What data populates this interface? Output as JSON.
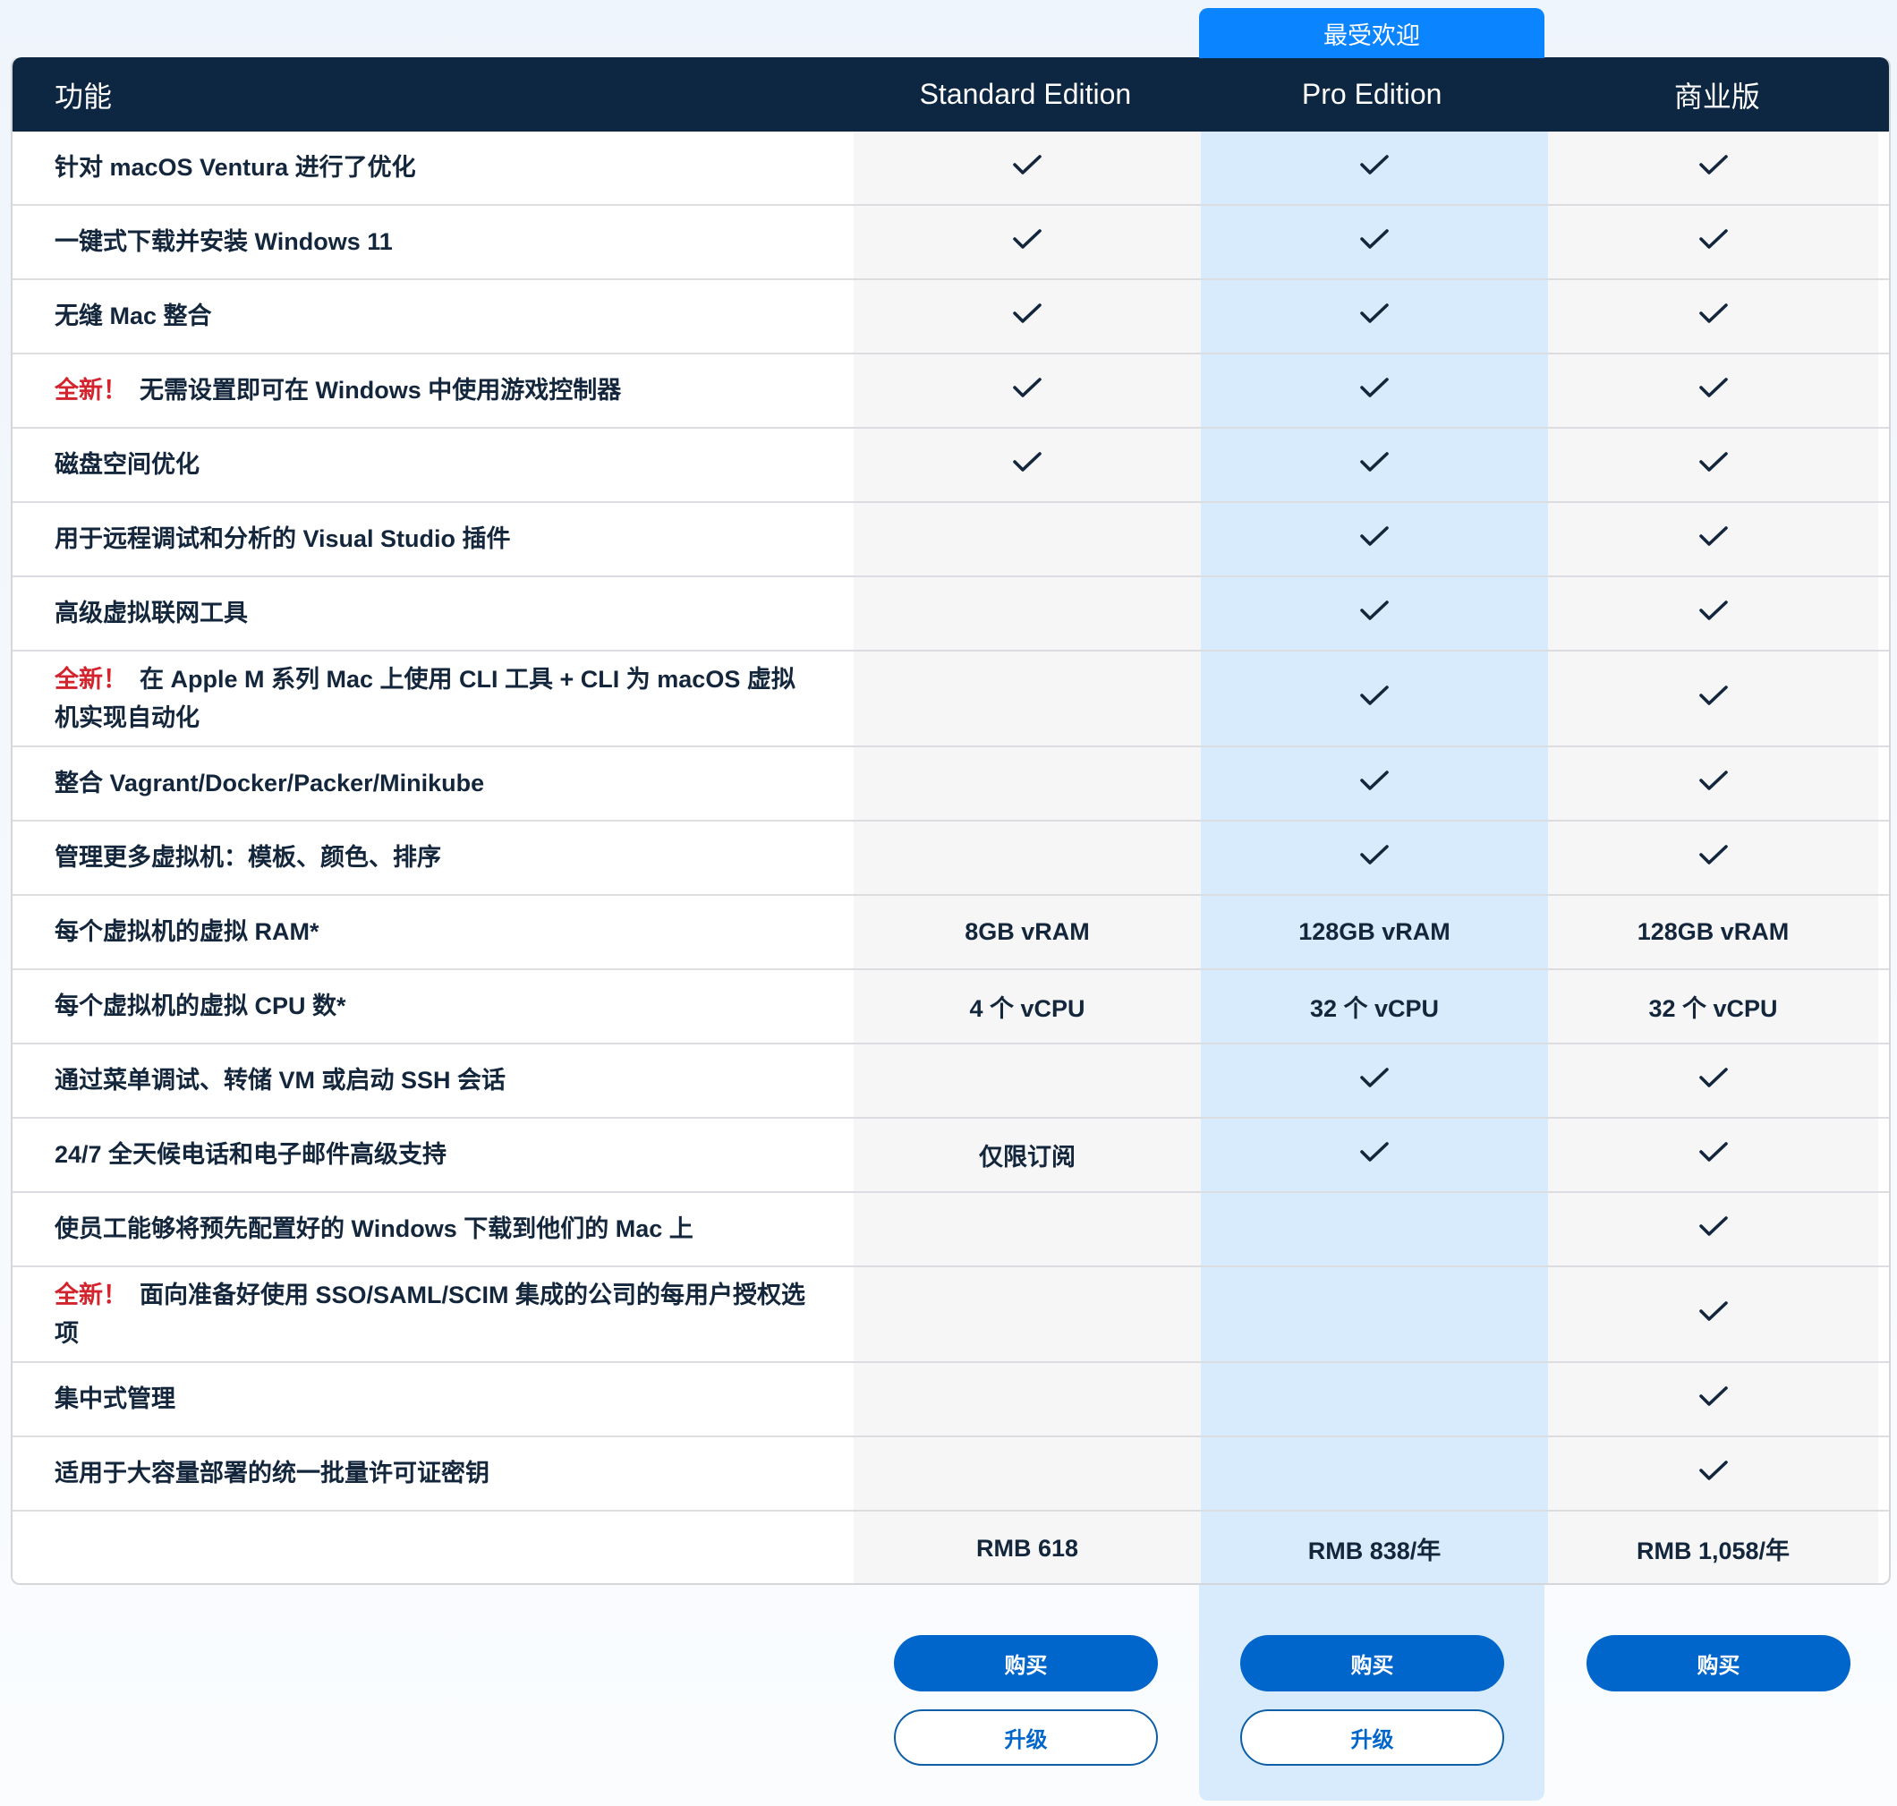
{
  "badge": "最受欢迎",
  "header": {
    "feature": "功能",
    "columns": [
      "Standard Edition",
      "Pro Edition",
      "商业版"
    ]
  },
  "new_label": "全新！",
  "check_icon": "checkmark-icon",
  "rows": [
    {
      "feature": "针对 macOS Ventura 进行了优化",
      "isNew": false,
      "values": [
        "check",
        "check",
        "check"
      ],
      "tall": false
    },
    {
      "feature": "一键式下载并安装 Windows 11",
      "isNew": false,
      "values": [
        "check",
        "check",
        "check"
      ],
      "tall": false
    },
    {
      "feature": "无缝 Mac 整合",
      "isNew": false,
      "values": [
        "check",
        "check",
        "check"
      ],
      "tall": false
    },
    {
      "feature": "无需设置即可在 Windows 中使用游戏控制器",
      "isNew": true,
      "values": [
        "check",
        "check",
        "check"
      ],
      "tall": false
    },
    {
      "feature": "磁盘空间优化",
      "isNew": false,
      "values": [
        "check",
        "check",
        "check"
      ],
      "tall": false
    },
    {
      "feature": "用于远程调试和分析的 Visual Studio 插件",
      "isNew": false,
      "values": [
        "",
        "check",
        "check"
      ],
      "tall": false
    },
    {
      "feature": "高级虚拟联网工具",
      "isNew": false,
      "values": [
        "",
        "check",
        "check"
      ],
      "tall": false
    },
    {
      "feature": "在 Apple M 系列 Mac 上使用 CLI 工具 + CLI 为 macOS 虚拟机实现自动化",
      "isNew": true,
      "values": [
        "",
        "check",
        "check"
      ],
      "tall": true
    },
    {
      "feature": "整合 Vagrant/Docker/Packer/Minikube",
      "isNew": false,
      "values": [
        "",
        "check",
        "check"
      ],
      "tall": false
    },
    {
      "feature": "管理更多虚拟机：模板、颜色、排序",
      "isNew": false,
      "values": [
        "",
        "check",
        "check"
      ],
      "tall": false
    },
    {
      "feature": "每个虚拟机的虚拟 RAM*",
      "isNew": false,
      "values": [
        "8GB vRAM",
        "128GB vRAM",
        "128GB vRAM"
      ],
      "tall": false
    },
    {
      "feature": "每个虚拟机的虚拟 CPU 数*",
      "isNew": false,
      "values": [
        "4 个 vCPU",
        "32 个 vCPU",
        "32 个 vCPU"
      ],
      "tall": false
    },
    {
      "feature": "通过菜单调试、转储 VM 或启动 SSH 会话",
      "isNew": false,
      "values": [
        "",
        "check",
        "check"
      ],
      "tall": false
    },
    {
      "feature": "24/7 全天候电话和电子邮件高级支持",
      "isNew": false,
      "values": [
        "仅限订阅",
        "check",
        "check"
      ],
      "tall": false
    },
    {
      "feature": "使员工能够将预先配置好的 Windows 下载到他们的 Mac 上",
      "isNew": false,
      "values": [
        "",
        "",
        "check"
      ],
      "tall": false
    },
    {
      "feature": "面向准备好使用 SSO/SAML/SCIM 集成的公司的每用户授权选项",
      "isNew": true,
      "values": [
        "",
        "",
        "check"
      ],
      "tall": true
    },
    {
      "feature": "集中式管理",
      "isNew": false,
      "values": [
        "",
        "",
        "check"
      ],
      "tall": false
    },
    {
      "feature": "适用于大容量部署的统一批量许可证密钥",
      "isNew": false,
      "values": [
        "",
        "",
        "check"
      ],
      "tall": false
    },
    {
      "feature": "",
      "isNew": false,
      "values": [
        "RMB 618",
        "RMB 838/年",
        "RMB 1,058/年"
      ],
      "tall": false
    }
  ],
  "actions": [
    {
      "edition": "Standard Edition",
      "buy": "购买",
      "upgrade": "升级"
    },
    {
      "edition": "Pro Edition",
      "buy": "购买",
      "upgrade": "升级"
    },
    {
      "edition": "商业版",
      "buy": "购买",
      "upgrade": null
    }
  ],
  "colors": {
    "header_bg": "#0d2642",
    "badge_bg": "#0a84ff",
    "pro_highlight": "#d8ebfc",
    "button_primary": "#0066cc",
    "new_label": "#d3242e"
  }
}
